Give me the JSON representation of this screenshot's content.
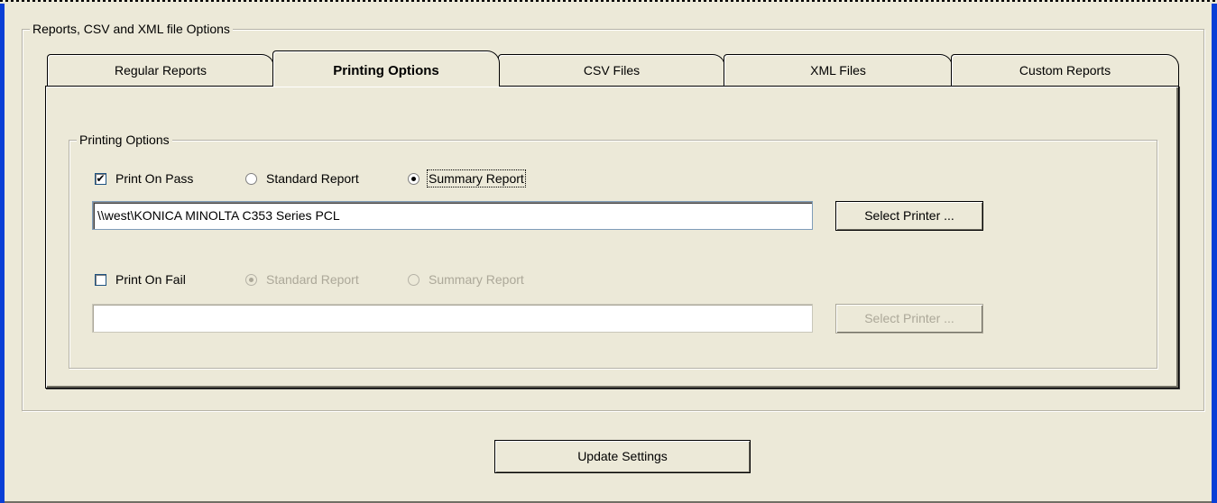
{
  "outer_group": {
    "legend": "Reports, CSV and XML file Options"
  },
  "tabs": [
    {
      "label": "Regular Reports",
      "active": false
    },
    {
      "label": "Printing Options",
      "active": true
    },
    {
      "label": "CSV Files",
      "active": false
    },
    {
      "label": "XML Files",
      "active": false
    },
    {
      "label": "Custom Reports",
      "active": false
    }
  ],
  "printing_group": {
    "legend": "Printing Options",
    "pass": {
      "checkbox_label": "Print On Pass",
      "checked": true,
      "radio_standard_label": "Standard Report",
      "radio_summary_label": "Summary Report",
      "selected": "summary",
      "printer_path": "\\\\west\\KONICA MINOLTA C353 Series PCL",
      "select_printer_label": "Select Printer ..."
    },
    "fail": {
      "checkbox_label": "Print On Fail",
      "checked": false,
      "radio_standard_label": "Standard Report",
      "radio_summary_label": "Summary Report",
      "selected": "standard",
      "printer_path": "",
      "select_printer_label": "Select Printer ..."
    }
  },
  "update_button_label": "Update Settings"
}
